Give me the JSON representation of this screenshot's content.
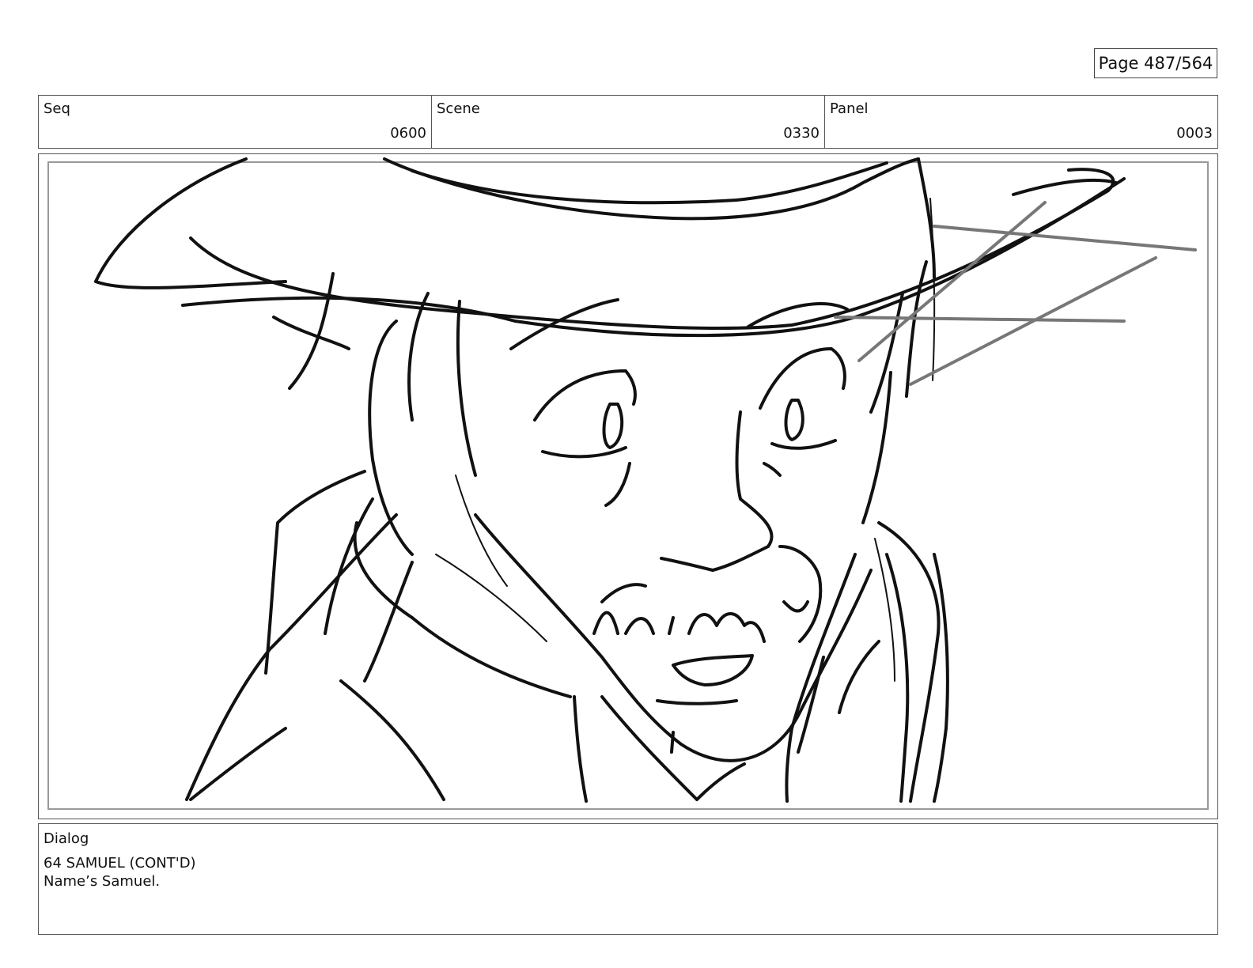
{
  "page": {
    "label": "Page 487/564"
  },
  "info": {
    "seq_label": "Seq",
    "seq_value": "0600",
    "scene_label": "Scene",
    "scene_value": "0330",
    "panel_label": "Panel",
    "panel_value": "0003"
  },
  "dialog": {
    "label": "Dialog",
    "lines": [
      "64 SAMUEL (CONT'D)",
      "Name’s Samuel."
    ]
  },
  "panel_image": {
    "icon": "storyboard-sketch-cowboy-icon",
    "stroke_color": "#111111",
    "guide_color": "#777777"
  }
}
